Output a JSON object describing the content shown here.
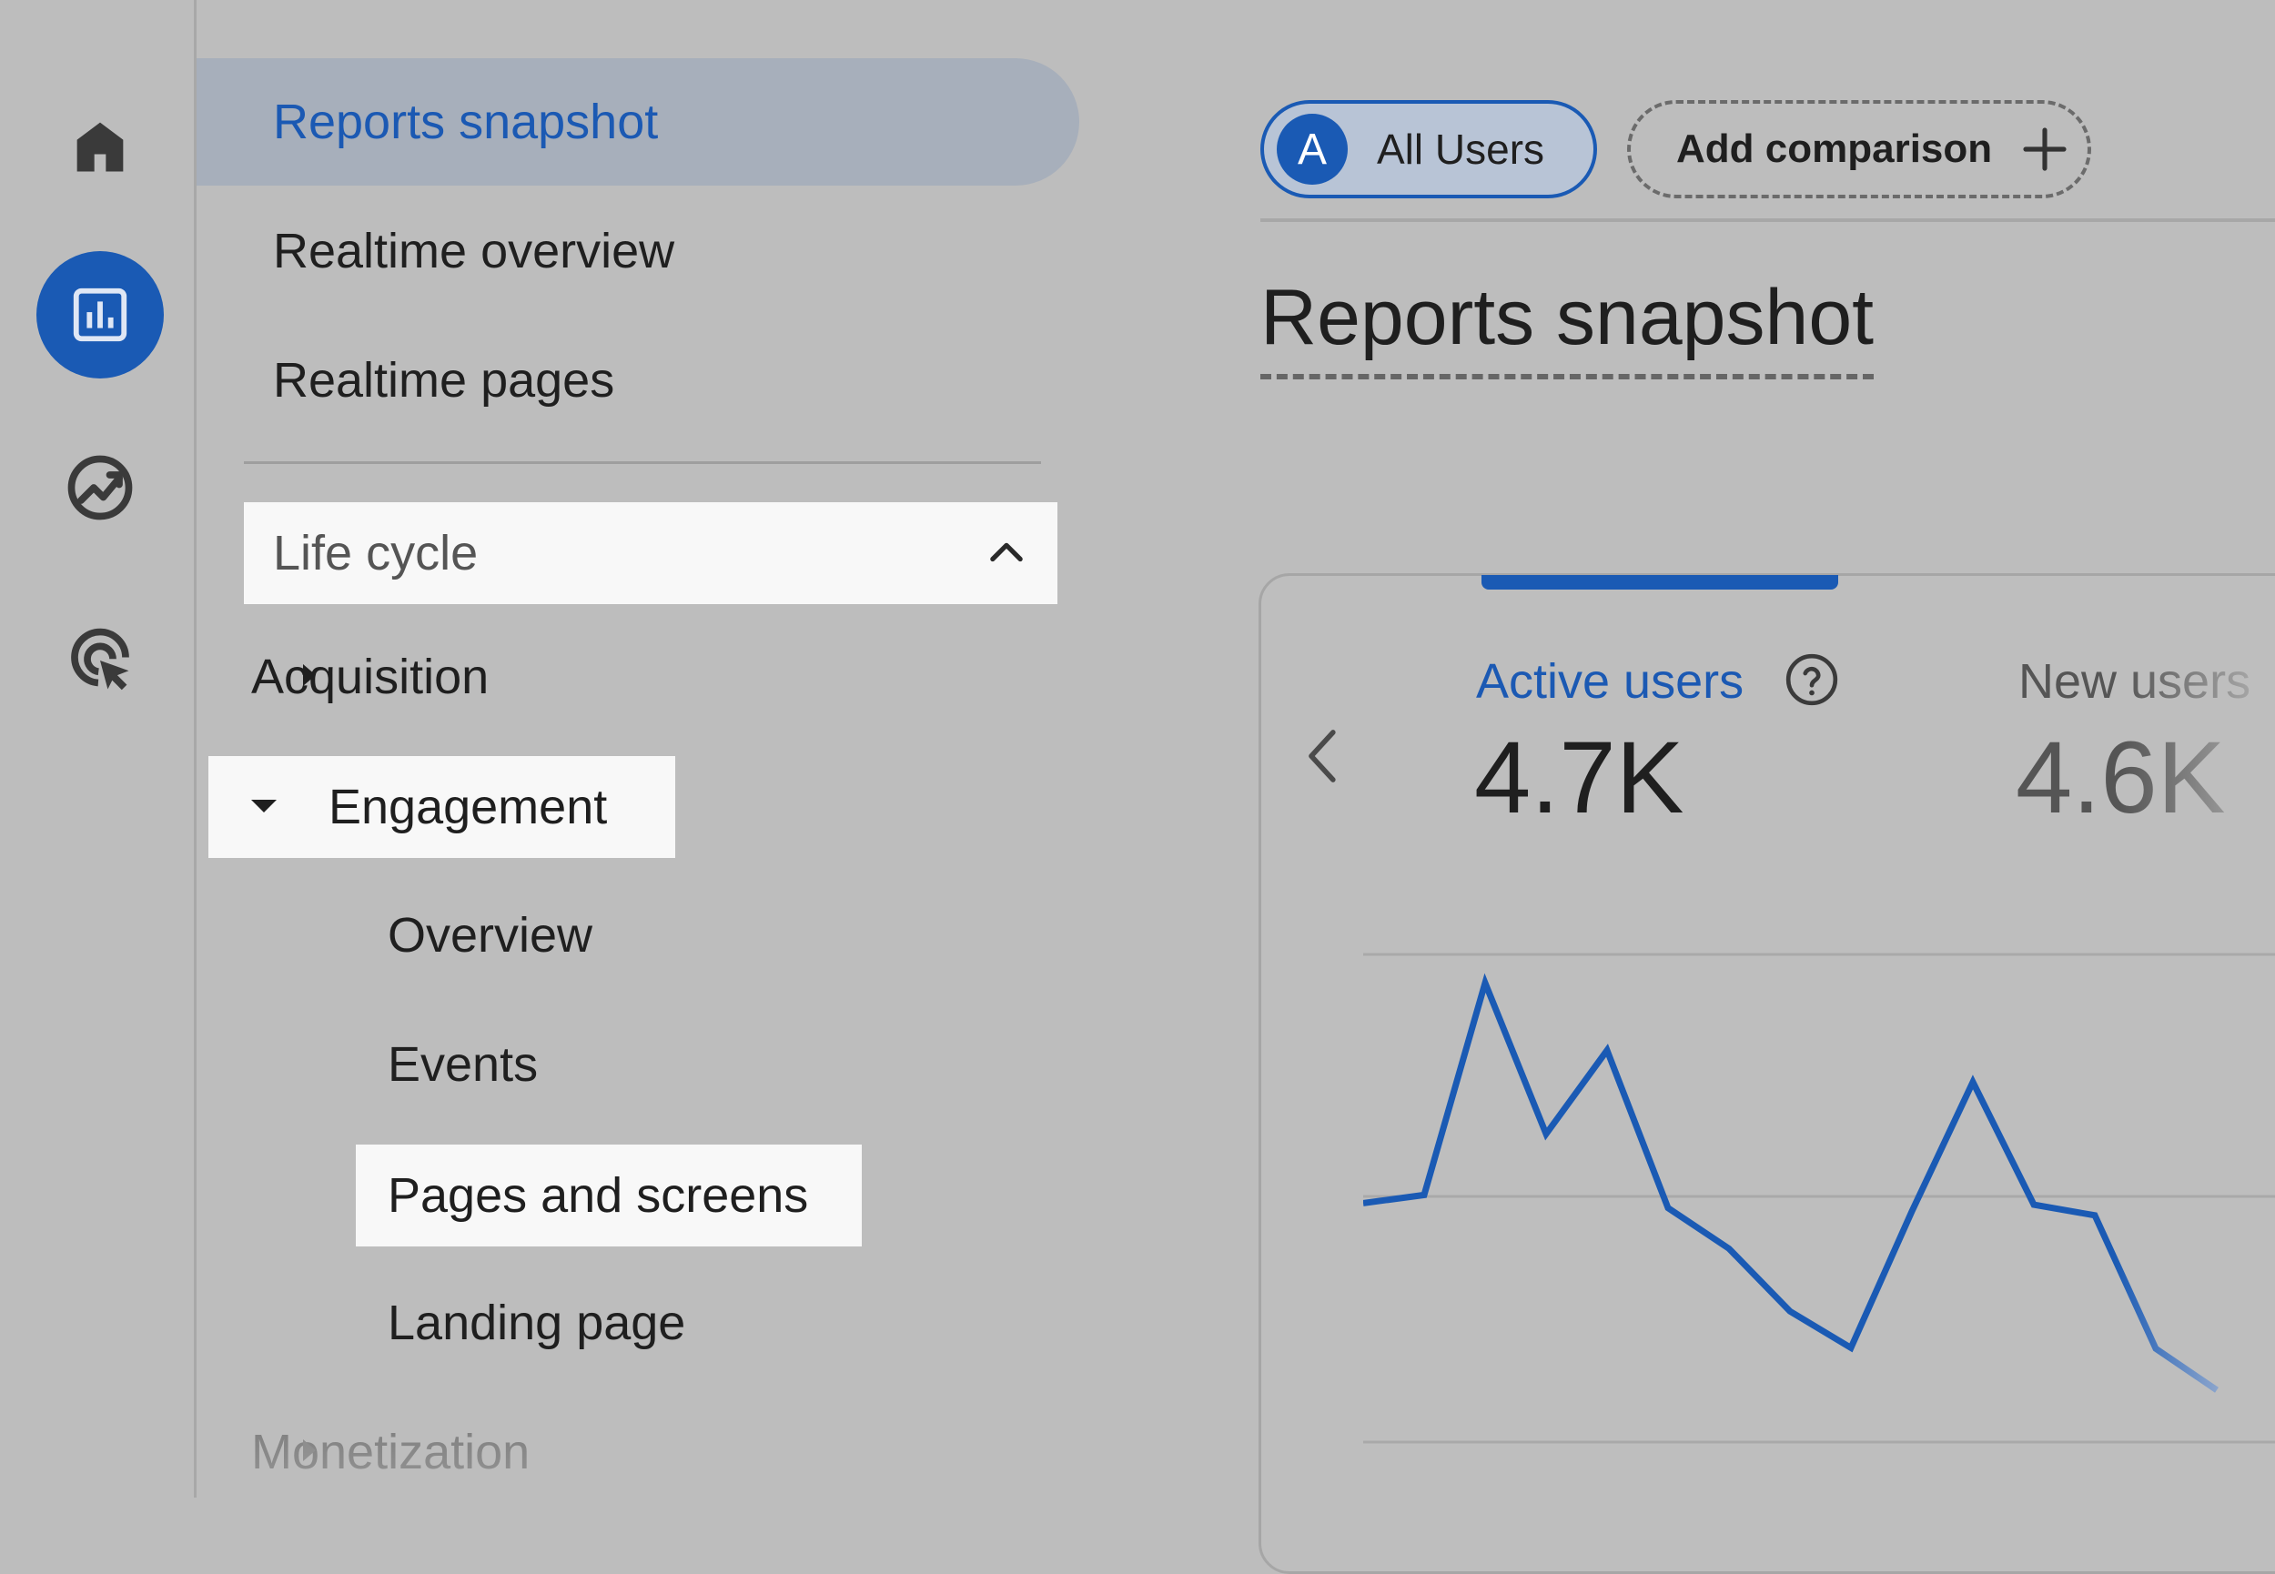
{
  "rail": {
    "items": [
      {
        "name": "home-icon"
      },
      {
        "name": "reports-icon",
        "active": true
      },
      {
        "name": "explore-icon"
      },
      {
        "name": "advertising-icon"
      }
    ]
  },
  "nav": {
    "items": [
      {
        "label": "Reports snapshot",
        "active": true
      },
      {
        "label": "Realtime overview"
      },
      {
        "label": "Realtime pages"
      }
    ],
    "section": {
      "label": "Life cycle",
      "expanded": true
    },
    "tree": {
      "acquisition": "Acquisition",
      "engagement": "Engagement",
      "engagement_children": [
        "Overview",
        "Events",
        "Pages and screens",
        "Landing page"
      ],
      "monetization": "Monetization"
    }
  },
  "header": {
    "segment": {
      "avatar": "A",
      "label": "All Users"
    },
    "add_comparison": "Add comparison"
  },
  "main": {
    "title": "Reports snapshot",
    "card": {
      "metrics": [
        {
          "label": "Active users",
          "value": "4.7K",
          "selected": true
        },
        {
          "label": "New users",
          "value": "4.6K"
        }
      ]
    }
  },
  "colors": {
    "accent": "#1a5ab4",
    "background": "#bdbdbd",
    "highlight": "#f8f8f8"
  },
  "chart_data": {
    "type": "line",
    "series": [
      {
        "values": [
          2.94,
          3.04,
          5.65,
          3.79,
          4.82,
          2.88,
          2.38,
          1.61,
          1.16,
          2.84,
          4.43,
          2.92,
          2.79,
          1.15,
          0.64
        ]
      }
    ],
    "grid": true,
    "xlabel": "",
    "ylabel": ""
  }
}
